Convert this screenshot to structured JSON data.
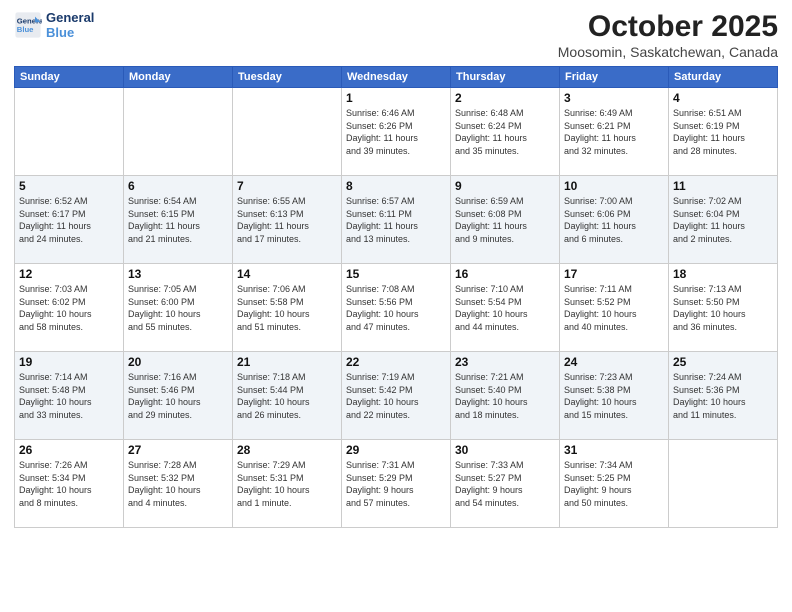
{
  "header": {
    "logo_line1": "General",
    "logo_line2": "Blue",
    "month": "October 2025",
    "location": "Moosomin, Saskatchewan, Canada"
  },
  "weekdays": [
    "Sunday",
    "Monday",
    "Tuesday",
    "Wednesday",
    "Thursday",
    "Friday",
    "Saturday"
  ],
  "weeks": [
    [
      {
        "day": "",
        "info": ""
      },
      {
        "day": "",
        "info": ""
      },
      {
        "day": "",
        "info": ""
      },
      {
        "day": "1",
        "info": "Sunrise: 6:46 AM\nSunset: 6:26 PM\nDaylight: 11 hours\nand 39 minutes."
      },
      {
        "day": "2",
        "info": "Sunrise: 6:48 AM\nSunset: 6:24 PM\nDaylight: 11 hours\nand 35 minutes."
      },
      {
        "day": "3",
        "info": "Sunrise: 6:49 AM\nSunset: 6:21 PM\nDaylight: 11 hours\nand 32 minutes."
      },
      {
        "day": "4",
        "info": "Sunrise: 6:51 AM\nSunset: 6:19 PM\nDaylight: 11 hours\nand 28 minutes."
      }
    ],
    [
      {
        "day": "5",
        "info": "Sunrise: 6:52 AM\nSunset: 6:17 PM\nDaylight: 11 hours\nand 24 minutes."
      },
      {
        "day": "6",
        "info": "Sunrise: 6:54 AM\nSunset: 6:15 PM\nDaylight: 11 hours\nand 21 minutes."
      },
      {
        "day": "7",
        "info": "Sunrise: 6:55 AM\nSunset: 6:13 PM\nDaylight: 11 hours\nand 17 minutes."
      },
      {
        "day": "8",
        "info": "Sunrise: 6:57 AM\nSunset: 6:11 PM\nDaylight: 11 hours\nand 13 minutes."
      },
      {
        "day": "9",
        "info": "Sunrise: 6:59 AM\nSunset: 6:08 PM\nDaylight: 11 hours\nand 9 minutes."
      },
      {
        "day": "10",
        "info": "Sunrise: 7:00 AM\nSunset: 6:06 PM\nDaylight: 11 hours\nand 6 minutes."
      },
      {
        "day": "11",
        "info": "Sunrise: 7:02 AM\nSunset: 6:04 PM\nDaylight: 11 hours\nand 2 minutes."
      }
    ],
    [
      {
        "day": "12",
        "info": "Sunrise: 7:03 AM\nSunset: 6:02 PM\nDaylight: 10 hours\nand 58 minutes."
      },
      {
        "day": "13",
        "info": "Sunrise: 7:05 AM\nSunset: 6:00 PM\nDaylight: 10 hours\nand 55 minutes."
      },
      {
        "day": "14",
        "info": "Sunrise: 7:06 AM\nSunset: 5:58 PM\nDaylight: 10 hours\nand 51 minutes."
      },
      {
        "day": "15",
        "info": "Sunrise: 7:08 AM\nSunset: 5:56 PM\nDaylight: 10 hours\nand 47 minutes."
      },
      {
        "day": "16",
        "info": "Sunrise: 7:10 AM\nSunset: 5:54 PM\nDaylight: 10 hours\nand 44 minutes."
      },
      {
        "day": "17",
        "info": "Sunrise: 7:11 AM\nSunset: 5:52 PM\nDaylight: 10 hours\nand 40 minutes."
      },
      {
        "day": "18",
        "info": "Sunrise: 7:13 AM\nSunset: 5:50 PM\nDaylight: 10 hours\nand 36 minutes."
      }
    ],
    [
      {
        "day": "19",
        "info": "Sunrise: 7:14 AM\nSunset: 5:48 PM\nDaylight: 10 hours\nand 33 minutes."
      },
      {
        "day": "20",
        "info": "Sunrise: 7:16 AM\nSunset: 5:46 PM\nDaylight: 10 hours\nand 29 minutes."
      },
      {
        "day": "21",
        "info": "Sunrise: 7:18 AM\nSunset: 5:44 PM\nDaylight: 10 hours\nand 26 minutes."
      },
      {
        "day": "22",
        "info": "Sunrise: 7:19 AM\nSunset: 5:42 PM\nDaylight: 10 hours\nand 22 minutes."
      },
      {
        "day": "23",
        "info": "Sunrise: 7:21 AM\nSunset: 5:40 PM\nDaylight: 10 hours\nand 18 minutes."
      },
      {
        "day": "24",
        "info": "Sunrise: 7:23 AM\nSunset: 5:38 PM\nDaylight: 10 hours\nand 15 minutes."
      },
      {
        "day": "25",
        "info": "Sunrise: 7:24 AM\nSunset: 5:36 PM\nDaylight: 10 hours\nand 11 minutes."
      }
    ],
    [
      {
        "day": "26",
        "info": "Sunrise: 7:26 AM\nSunset: 5:34 PM\nDaylight: 10 hours\nand 8 minutes."
      },
      {
        "day": "27",
        "info": "Sunrise: 7:28 AM\nSunset: 5:32 PM\nDaylight: 10 hours\nand 4 minutes."
      },
      {
        "day": "28",
        "info": "Sunrise: 7:29 AM\nSunset: 5:31 PM\nDaylight: 10 hours\nand 1 minute."
      },
      {
        "day": "29",
        "info": "Sunrise: 7:31 AM\nSunset: 5:29 PM\nDaylight: 9 hours\nand 57 minutes."
      },
      {
        "day": "30",
        "info": "Sunrise: 7:33 AM\nSunset: 5:27 PM\nDaylight: 9 hours\nand 54 minutes."
      },
      {
        "day": "31",
        "info": "Sunrise: 7:34 AM\nSunset: 5:25 PM\nDaylight: 9 hours\nand 50 minutes."
      },
      {
        "day": "",
        "info": ""
      }
    ]
  ]
}
